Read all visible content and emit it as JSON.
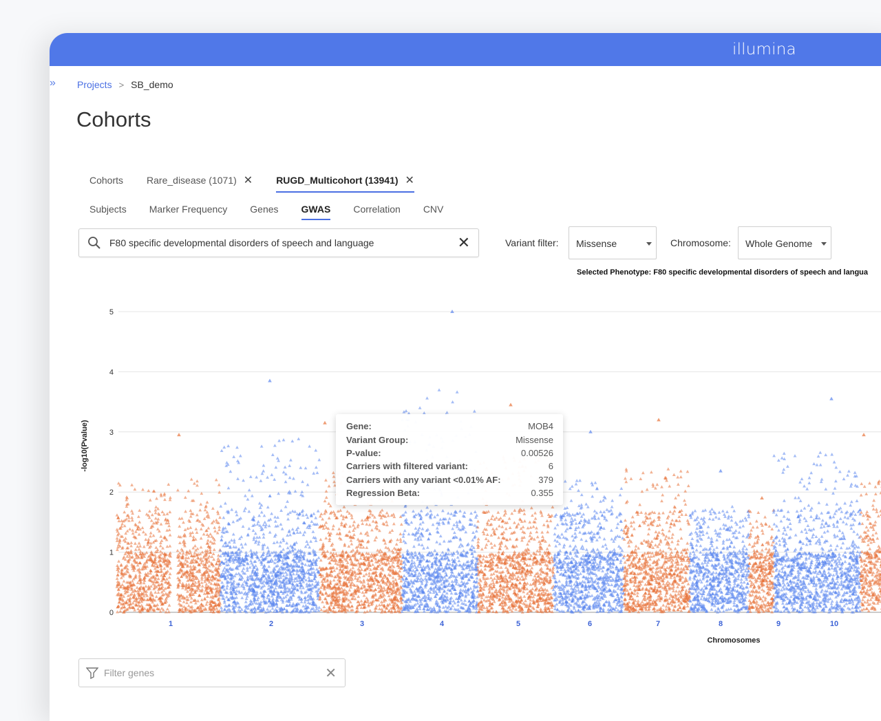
{
  "header": {
    "brand": "illumina",
    "brand_color": "#5078e8"
  },
  "breadcrumb": {
    "projects": "Projects",
    "separator": ">",
    "current": "SB_demo"
  },
  "page_title": "Cohorts",
  "cohort_tabs": [
    {
      "label": "Cohorts",
      "closable": false,
      "active": false
    },
    {
      "label": "Rare_disease (1071)",
      "closable": true,
      "active": false
    },
    {
      "label": "RUGD_Multicohort (13941)",
      "closable": true,
      "active": true
    }
  ],
  "sub_tabs": [
    {
      "label": "Subjects",
      "active": false
    },
    {
      "label": "Marker Frequency",
      "active": false
    },
    {
      "label": "Genes",
      "active": false
    },
    {
      "label": "GWAS",
      "active": true
    },
    {
      "label": "Correlation",
      "active": false
    },
    {
      "label": "CNV",
      "active": false
    }
  ],
  "phenotype_search": {
    "value": "F80 specific developmental disorders of speech and language",
    "icon": "search-icon"
  },
  "variant_filter": {
    "label": "Variant filter:",
    "value": "Missense"
  },
  "chromosome_filter": {
    "label": "Chromosome:",
    "value": "Whole Genome"
  },
  "selected_phenotype_note": "Selected Phenotype: F80 specific developmental disorders of speech and langua",
  "chart_data": {
    "type": "scatter",
    "title": "",
    "xlabel": "Chromosomes",
    "ylabel": "-log10(Pvalue)",
    "ylim": [
      0,
      5
    ],
    "yticks": [
      0,
      1,
      2,
      3,
      4,
      5
    ],
    "grid": true,
    "colors": {
      "odd_chromosome": "#e8733a",
      "even_chromosome": "#5b86ee"
    },
    "chromosomes": [
      {
        "label": "1",
        "max": 2.95
      },
      {
        "label": "2",
        "max": 3.85
      },
      {
        "label": "3",
        "max": 3.15
      },
      {
        "label": "4",
        "max": 5.0
      },
      {
        "label": "5",
        "max": 3.45
      },
      {
        "label": "6",
        "max": 3.0
      },
      {
        "label": "7",
        "max": 3.2
      },
      {
        "label": "8",
        "max": 2.35
      },
      {
        "label": "9",
        "max": 1.9
      },
      {
        "label": "10",
        "max": 3.55
      },
      {
        "label": "",
        "max": 2.95
      }
    ]
  },
  "tooltip": {
    "rows": [
      {
        "label": "Gene:",
        "value": "MOB4"
      },
      {
        "label": "Variant Group:",
        "value": "Missense"
      },
      {
        "label": "P-value:",
        "value": "0.00526"
      },
      {
        "label": "Carriers with filtered variant:",
        "value": "6"
      },
      {
        "label": "Carriers with any variant <0.01% AF:",
        "value": "379"
      },
      {
        "label": "Regression Beta:",
        "value": "0.355"
      }
    ]
  },
  "gene_filter": {
    "placeholder": "Filter genes"
  }
}
